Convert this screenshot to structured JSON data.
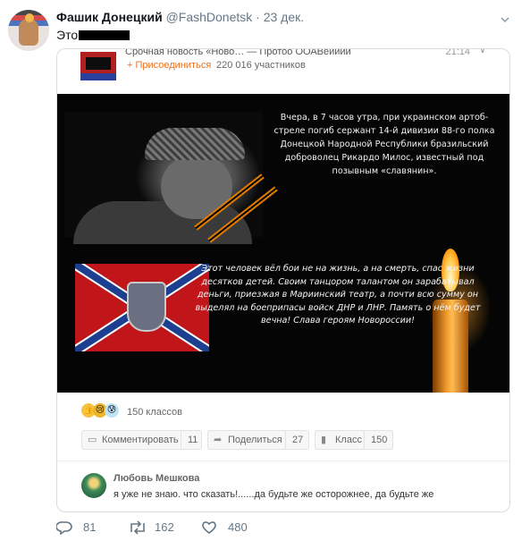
{
  "tweet": {
    "author_name": "Фашик Донецкий",
    "author_handle": "@FashDonetsk",
    "separator": "·",
    "date": "23 дек.",
    "text": "Это"
  },
  "card": {
    "group_title": "Срочная новость «Ново… — Протоо ООАВеииии",
    "time": "21:14",
    "join_label": "+ Присоединиться",
    "members": "220 016 участников",
    "image_text_1": "Вчера, в 7 часов утра, при украинском артоб-стреле погиб сержант 14-й дивизии 88-го полка Донецкой Народной Республики бразильский доброволец Рикардо Милос, известный под позывным «славянин».",
    "image_text_2": "Этот человек вёл бои не на жизнь, а на смерть, спас жизни десятков детей. Своим танцором талантом он зарабатывал деньги, приезжая в Мариинский театр, а почти всю сумму он выделял на боеприпасы войск ДНР и ЛНР. Память о нём будет вечна! Слава героям Новороссии!",
    "reactions_count": "150 классов",
    "actions": [
      {
        "icon": "speech-bubble-icon",
        "label": "Комментировать",
        "count": "11"
      },
      {
        "icon": "share-arrow-icon",
        "label": "Поделиться",
        "count": "27"
      },
      {
        "icon": "thumbs-up-icon",
        "label": "Класс",
        "count": "150"
      }
    ],
    "comment": {
      "author": "Любовь Мешкова",
      "text": "я уже не знаю. что сказать!......да будьте же осторожнее, да будьте же"
    }
  },
  "tweet_actions": {
    "replies": "81",
    "retweets": "162",
    "likes": "480"
  },
  "colors": {
    "ok_orange": "#eb7222",
    "twitter_gray": "#657786",
    "redaction": "#000000"
  }
}
